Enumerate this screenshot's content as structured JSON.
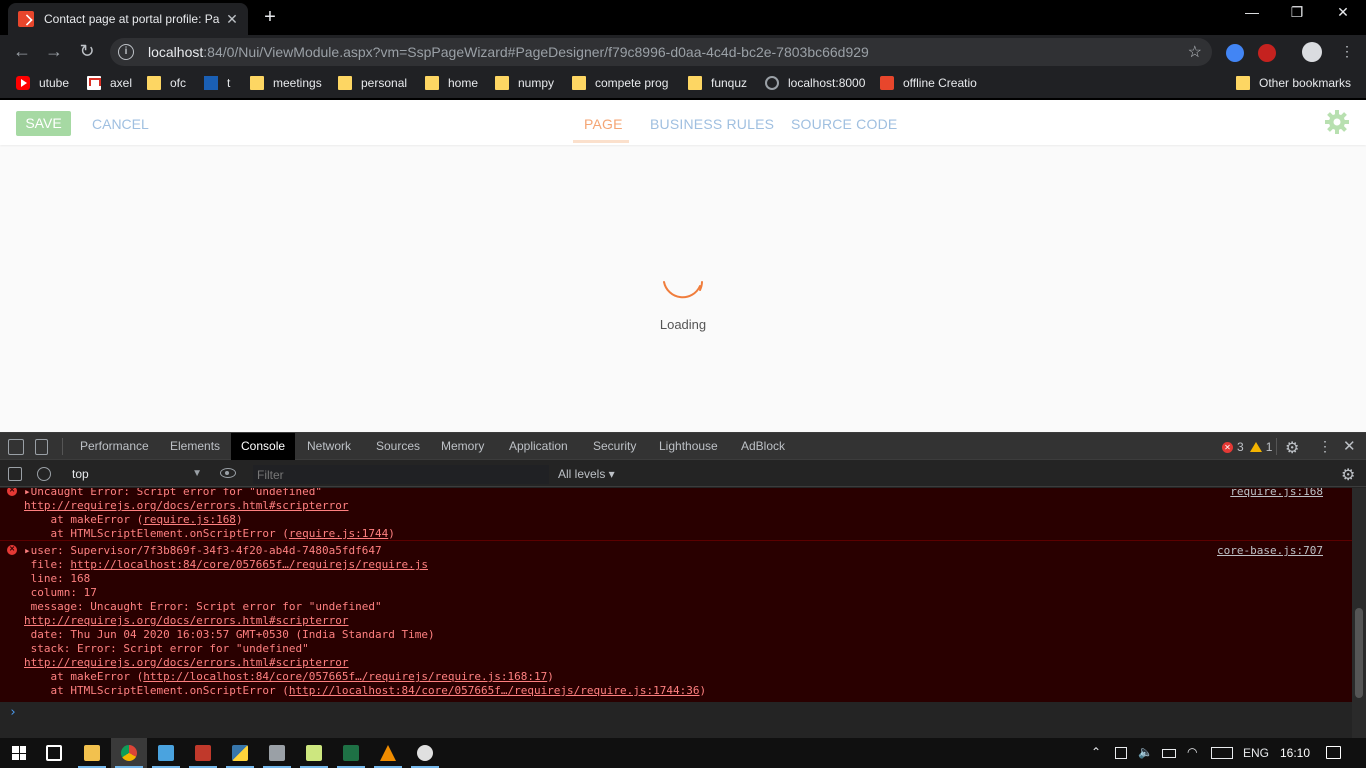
{
  "browser": {
    "tab_title": "Contact page at portal profile: Pa",
    "tab_close": "✕",
    "new_tab": "+",
    "window_controls": {
      "minimize": "—",
      "restore": "❐",
      "close": "✕"
    },
    "url_host": "localhost",
    "url_rest": ":84/0/Nui/ViewModule.aspx?vm=SspPageWizard#PageDesigner/f79c8996-d0aa-4c4d-bc2e-7803bc66d929",
    "nav": {
      "back": "←",
      "forward": "→",
      "reload": "↻",
      "star": "☆",
      "menu": "⋮"
    },
    "bookmarks": [
      {
        "label": "utube",
        "icon": "youtube-icon"
      },
      {
        "label": "axel",
        "icon": "gmail-icon"
      },
      {
        "label": "ofc",
        "icon": "folder-icon"
      },
      {
        "label": "t",
        "icon": "tata-icon"
      },
      {
        "label": "meetings",
        "icon": "folder-icon"
      },
      {
        "label": "personal",
        "icon": "folder-icon"
      },
      {
        "label": "home",
        "icon": "folder-icon"
      },
      {
        "label": "numpy",
        "icon": "folder-icon"
      },
      {
        "label": "compete prog",
        "icon": "folder-icon"
      },
      {
        "label": "funquz",
        "icon": "folder-icon"
      },
      {
        "label": "localhost:8000",
        "icon": "globe-icon"
      },
      {
        "label": "offline Creatio",
        "icon": "creatio-icon"
      }
    ],
    "other_bookmarks": "Other bookmarks"
  },
  "app": {
    "save_label": "SAVE",
    "cancel_label": "CANCEL",
    "tabs": [
      {
        "label": "PAGE",
        "active": true
      },
      {
        "label": "BUSINESS RULES",
        "active": false
      },
      {
        "label": "SOURCE CODE",
        "active": false
      }
    ],
    "loading_text": "Loading",
    "accent_color": "#f4a574",
    "save_color": "#a6d9a3"
  },
  "devtools": {
    "tabs": [
      "Performance",
      "Elements",
      "Console",
      "Network",
      "Sources",
      "Memory",
      "Application",
      "Security",
      "Lighthouse",
      "AdBlock"
    ],
    "active_tab": "Console",
    "error_count": "3",
    "warning_count": "1",
    "context": "top",
    "filter_placeholder": "Filter",
    "levels": "All levels ▾",
    "messages": [
      {
        "source": "require.js:168",
        "lines": [
          {
            "text": "▸Uncaught Error: Script error for \"undefined\"",
            "link": false
          },
          {
            "text": "http://requirejs.org/docs/errors.html#scripterror",
            "link": true
          },
          {
            "prefix": "    at makeError (",
            "linktext": "require.js:168",
            "suffix": ")"
          },
          {
            "prefix": "    at HTMLScriptElement.onScriptError (",
            "linktext": "require.js:1744",
            "suffix": ")"
          }
        ]
      },
      {
        "source": "core-base.js:707",
        "lines": [
          {
            "text": "▸user: Supervisor/7f3b869f-34f3-4f20-ab4d-7480a5fdf647",
            "link": false
          },
          {
            "prefix": " file: ",
            "linktext": "http://localhost:84/core/057665f…/requirejs/require.js",
            "suffix": ""
          },
          {
            "text": " line: 168",
            "link": false
          },
          {
            "text": " column: 17",
            "link": false
          },
          {
            "text": " message: Uncaught Error: Script error for \"undefined\"",
            "link": false
          },
          {
            "text": "http://requirejs.org/docs/errors.html#scripterror",
            "link": true
          },
          {
            "text": " date: Thu Jun 04 2020 16:03:57 GMT+0530 (India Standard Time)",
            "link": false
          },
          {
            "text": " stack: Error: Script error for \"undefined\"",
            "link": false
          },
          {
            "text": "http://requirejs.org/docs/errors.html#scripterror",
            "link": true
          },
          {
            "prefix": "    at makeError (",
            "linktext": "http://localhost:84/core/057665f…/requirejs/require.js:168:17",
            "suffix": ")"
          },
          {
            "prefix": "    at HTMLScriptElement.onScriptError (",
            "linktext": "http://localhost:84/core/057665f…/requirejs/require.js:1744:36",
            "suffix": ")"
          }
        ]
      }
    ],
    "prompt": "›"
  },
  "taskbar": {
    "language": "ENG",
    "time": "16:10"
  }
}
